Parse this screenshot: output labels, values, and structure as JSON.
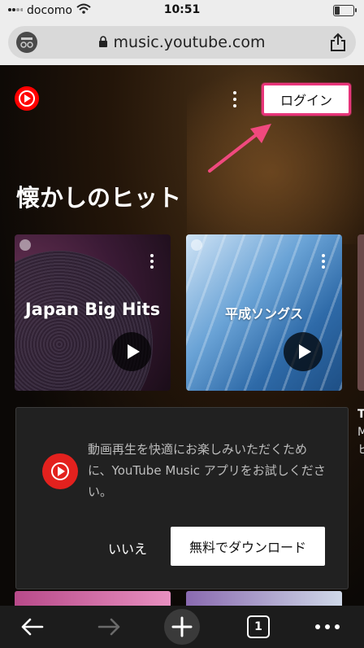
{
  "status_bar": {
    "carrier": "docomo",
    "time": "10:51",
    "battery_level": 0.25
  },
  "browser": {
    "url": "music.youtube.com"
  },
  "header": {
    "login_label": "ログイン"
  },
  "section": {
    "title": "懐かしのヒット"
  },
  "cards": [
    {
      "title": "Japan Big Hits"
    },
    {
      "title": "平成ソングス"
    }
  ],
  "peek": {
    "line1": "T",
    "line2": "M",
    "line3": "ヒ"
  },
  "dialog": {
    "message": "動画再生を快適にお楽しみいただくために、YouTube Music アプリをお試しください。",
    "cancel_label": "いいえ",
    "download_label": "無料でダウンロード"
  },
  "toolbar": {
    "tab_count": "1"
  },
  "colors": {
    "accent_pink": "#e8357a",
    "youtube_red": "#ff0000",
    "dialog_bg": "#212121"
  },
  "icons": [
    "wifi-icon",
    "lock-icon",
    "share-icon",
    "incognito-icon",
    "youtube-music-logo-icon",
    "kebab-menu-icon",
    "arrow-annotation-icon",
    "play-icon",
    "back-arrow-icon",
    "forward-arrow-icon",
    "plus-icon",
    "tabs-icon",
    "more-dots-icon"
  ]
}
